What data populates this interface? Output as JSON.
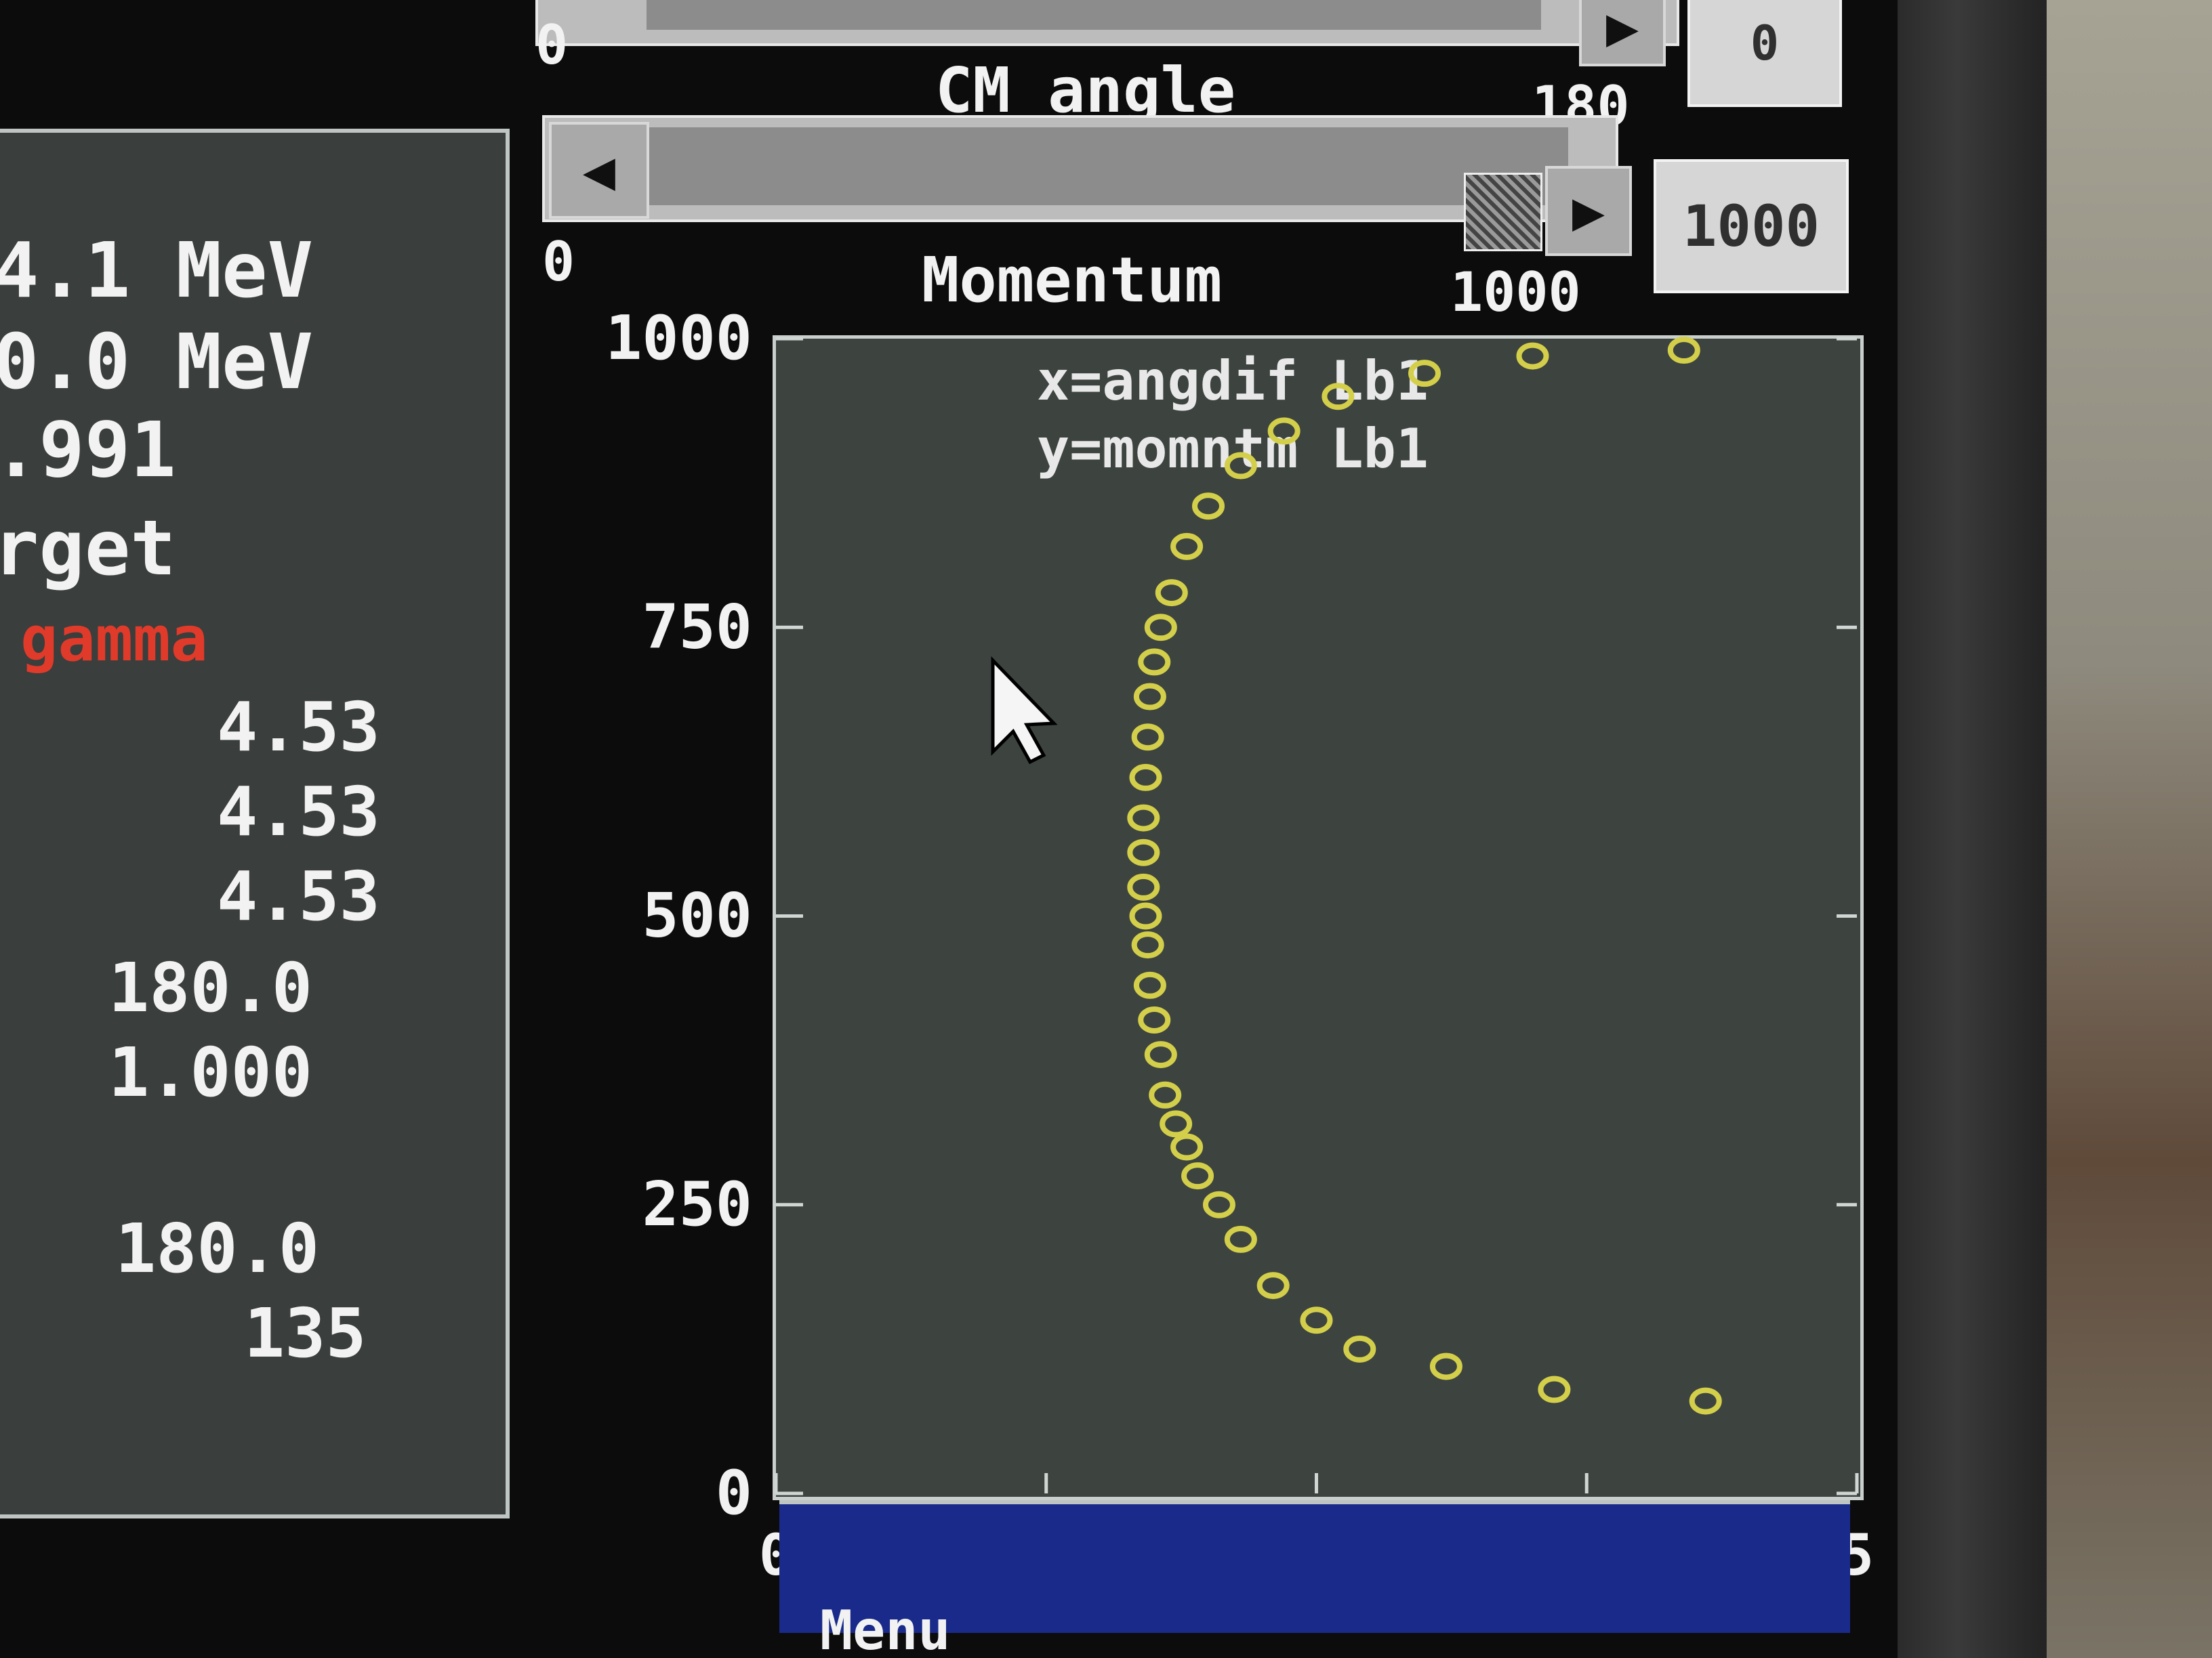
{
  "sliders": {
    "top": {
      "min_label": "0",
      "title": "CM angle",
      "max_label": "180",
      "value": "0"
    },
    "momentum": {
      "min_label": "0",
      "title": "Momentum",
      "max_label": "1000",
      "value": "1000"
    }
  },
  "info_panel": {
    "rows": [
      "4.1 MeV",
      "0.0 MeV",
      ".991",
      "rget"
    ],
    "highlight": "gamma",
    "values": [
      "4.53",
      "4.53",
      "4.53",
      "180.0",
      "1.000",
      "180.0",
      "135"
    ]
  },
  "plot": {
    "legend_x": "x=angdif Lb1",
    "legend_y": "y=momntm Lb1",
    "marker_color": "#d4cf4a"
  },
  "chart_data": {
    "type": "scatter",
    "title": "",
    "xlabel": "",
    "ylabel": "",
    "xlim": [
      0,
      50
    ],
    "ylim": [
      0,
      1000
    ],
    "xticks": [
      "0",
      "12.5",
      "25",
      "37.5",
      "5"
    ],
    "yticks": [
      "0",
      "250",
      "500",
      "750",
      "1000"
    ],
    "series": [
      {
        "x": [
          43,
          36,
          31,
          27,
          25,
          23,
          21.5,
          20.5,
          19.5,
          19,
          18.5,
          18,
          17.8,
          17.5,
          17.3,
          17.2,
          17.1,
          17,
          17,
          17,
          17.1,
          17.2,
          17.3,
          17.5,
          17.8,
          18.3,
          19,
          20,
          21.5,
          23.5,
          26,
          30,
          35,
          42
        ],
        "y": [
          80,
          90,
          110,
          125,
          150,
          180,
          220,
          250,
          275,
          300,
          320,
          345,
          380,
          410,
          440,
          475,
          500,
          525,
          555,
          585,
          620,
          655,
          690,
          720,
          750,
          780,
          820,
          855,
          890,
          920,
          950,
          970,
          985,
          990
        ]
      }
    ]
  },
  "taskbar": {
    "menu_label": "Menu"
  }
}
